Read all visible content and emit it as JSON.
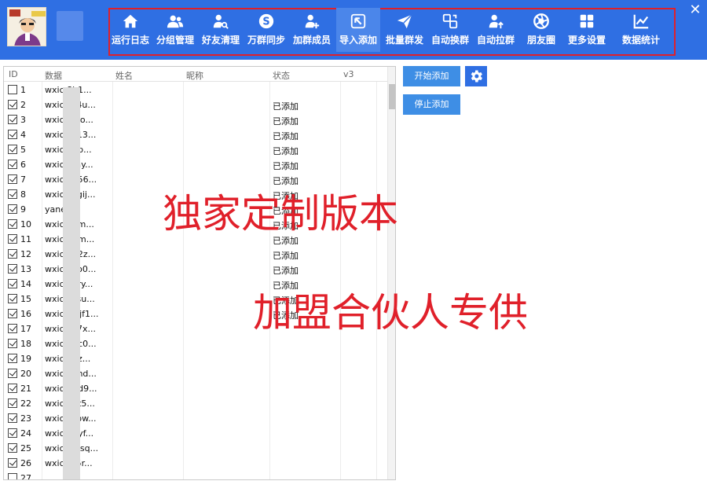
{
  "window": {
    "close_glyph": "✕"
  },
  "logo": {
    "icon": "avatar-logo-icon"
  },
  "nav": [
    {
      "label": "运行日志",
      "icon": "home-icon"
    },
    {
      "label": "分组管理",
      "icon": "users-icon"
    },
    {
      "label": "好友清理",
      "icon": "user-search-icon"
    },
    {
      "label": "万群同步",
      "icon": "sync-icon"
    },
    {
      "label": "加群成员",
      "icon": "user-add-icon"
    },
    {
      "label": "导入添加",
      "icon": "import-icon",
      "active": true
    },
    {
      "label": "批量群发",
      "icon": "send-icon"
    },
    {
      "label": "自动换群",
      "icon": "swap-icon"
    },
    {
      "label": "自动拉群",
      "icon": "user-up-icon"
    },
    {
      "label": "朋友圈",
      "icon": "aperture-icon"
    },
    {
      "label": "更多设置",
      "icon": "grid-icon"
    },
    {
      "label": "数据统计",
      "icon": "chart-icon"
    }
  ],
  "table": {
    "headers": {
      "id": "ID",
      "data": "数据",
      "name": "姓名",
      "nickname": "昵称",
      "status": "状态",
      "v3": "v3"
    },
    "rows": [
      {
        "id": "1",
        "checked": false,
        "data": "wxic     8h1...",
        "status": ""
      },
      {
        "id": "2",
        "checked": true,
        "data": "wxic     zy4u...",
        "status": "已添加"
      },
      {
        "id": "3",
        "checked": true,
        "data": "wxic     0lao...",
        "status": "已添加"
      },
      {
        "id": "4",
        "checked": true,
        "data": "wxic     z413...",
        "status": "已添加"
      },
      {
        "id": "5",
        "checked": true,
        "data": "wxic     77p...",
        "status": "已添加"
      },
      {
        "id": "6",
        "checked": true,
        "data": "wxic     tday...",
        "status": "已添加"
      },
      {
        "id": "7",
        "checked": true,
        "data": "wxic     dy56...",
        "status": "已添加"
      },
      {
        "id": "8",
        "checked": true,
        "data": "wxic     1zgij...",
        "status": "已添加"
      },
      {
        "id": "9",
        "checked": true,
        "data": "yane",
        "status": "已添加"
      },
      {
        "id": "10",
        "checked": true,
        "data": "wxic     2ym...",
        "status": "已添加"
      },
      {
        "id": "11",
        "checked": true,
        "data": "wxic     jbfm...",
        "status": "已添加"
      },
      {
        "id": "12",
        "checked": true,
        "data": "wxic     o22z...",
        "status": "已添加"
      },
      {
        "id": "13",
        "checked": true,
        "data": "wxic     kuo0...",
        "status": "已添加"
      },
      {
        "id": "14",
        "checked": true,
        "data": "wxic     kqry...",
        "status": "已添加"
      },
      {
        "id": "15",
        "checked": true,
        "data": "wxic     kcsu...",
        "status": "已添加"
      },
      {
        "id": "16",
        "checked": true,
        "data": "wxic     9wjf1...",
        "status": "已添加"
      },
      {
        "id": "17",
        "checked": true,
        "data": "wxic     llo7x...",
        "status": ""
      },
      {
        "id": "18",
        "checked": true,
        "data": "wxic     7gc0...",
        "status": ""
      },
      {
        "id": "19",
        "checked": true,
        "data": "wxic     i9fz...",
        "status": ""
      },
      {
        "id": "20",
        "checked": true,
        "data": "wxic     qkhd...",
        "status": ""
      },
      {
        "id": "21",
        "checked": true,
        "data": "wxic     g1d9...",
        "status": ""
      },
      {
        "id": "22",
        "checked": true,
        "data": "wxic     9ut5...",
        "status": ""
      },
      {
        "id": "23",
        "checked": true,
        "data": "wxic     vsow...",
        "status": ""
      },
      {
        "id": "24",
        "checked": true,
        "data": "wxic     6byf...",
        "status": ""
      },
      {
        "id": "25",
        "checked": true,
        "data": "wxic     1iesq...",
        "status": ""
      },
      {
        "id": "26",
        "checked": true,
        "data": "wxic     r85r...",
        "status": ""
      },
      {
        "id": "27",
        "checked": false,
        "data": "",
        "status": ""
      }
    ]
  },
  "actions": {
    "start_label": "开始添加",
    "stop_label": "停止添加",
    "settings_icon": "gear-icon"
  },
  "watermark": {
    "line1": "独家定制版本",
    "line2": "加盟合伙人专供"
  },
  "colors": {
    "topbar": "#2f6fe3",
    "button": "#3e8ee5",
    "watermark": "#e0202a",
    "highlight_frame": "#e0202a"
  }
}
